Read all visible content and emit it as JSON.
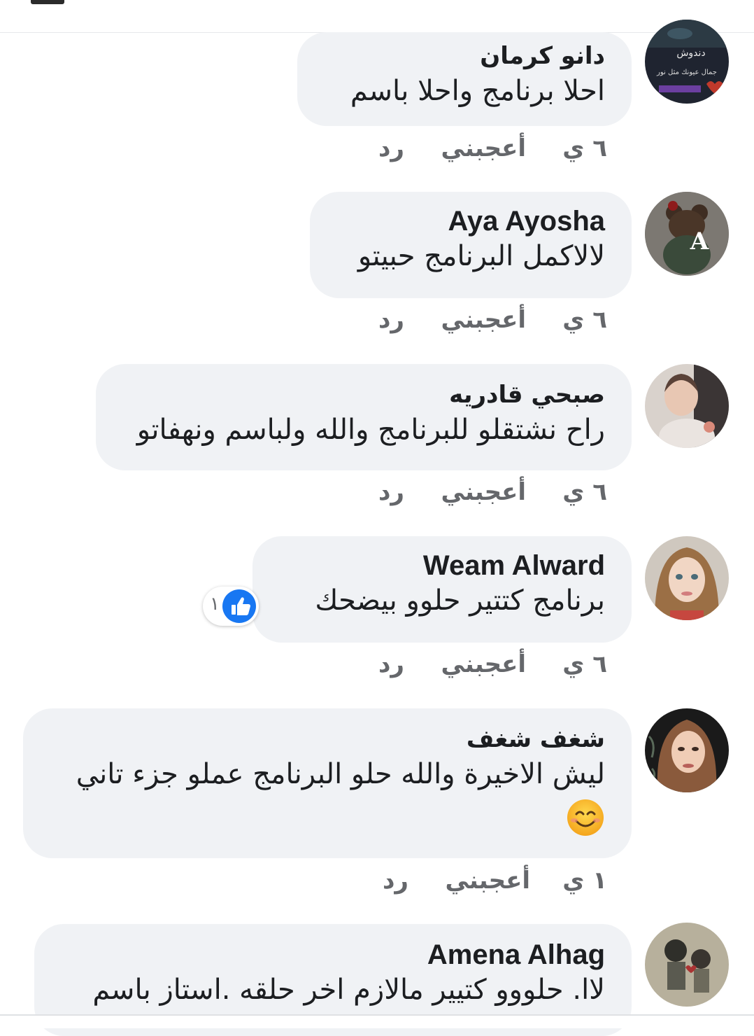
{
  "comments": [
    {
      "author": "دانو كرمان",
      "text": "احلا برنامج واحلا باسم",
      "time": "٦ ي",
      "like_label": "أعجبني",
      "reply_label": "رد",
      "avatar_text": "دندوش",
      "avatar_subtext": "جمال عيونك مثل نور"
    },
    {
      "author": "Aya Ayosha",
      "text": "لالاكمل البرنامج حبيتو",
      "time": "٦ ي",
      "like_label": "أعجبني",
      "reply_label": "رد",
      "avatar_letter": "A"
    },
    {
      "author": "صبحي قادريه",
      "text": "راح نشتقلو للبرنامج والله ولباسم ونهفاتو",
      "time": "٦ ي",
      "like_label": "أعجبني",
      "reply_label": "رد"
    },
    {
      "author": "Weam Alward",
      "text": "برنامج كتتير حلوو بيضحك",
      "time": "٦ ي",
      "like_label": "أعجبني",
      "reply_label": "رد",
      "reaction_count": "١"
    },
    {
      "author": "شغف شغف",
      "text": "ليش الاخيرة والله حلو البرنامج عملو جزء تاني",
      "time": "١ ي",
      "like_label": "أعجبني",
      "reply_label": "رد",
      "emoji": "smiling-face"
    },
    {
      "author": "Amena Alhag",
      "text": "لاا. حلووو كتيير مالازم اخر حلقه .استاز باسم"
    }
  ],
  "colors": {
    "bubble": "#f0f2f5",
    "text": "#1c1e21",
    "meta": "#65676b",
    "reaction": "#1877f2"
  }
}
